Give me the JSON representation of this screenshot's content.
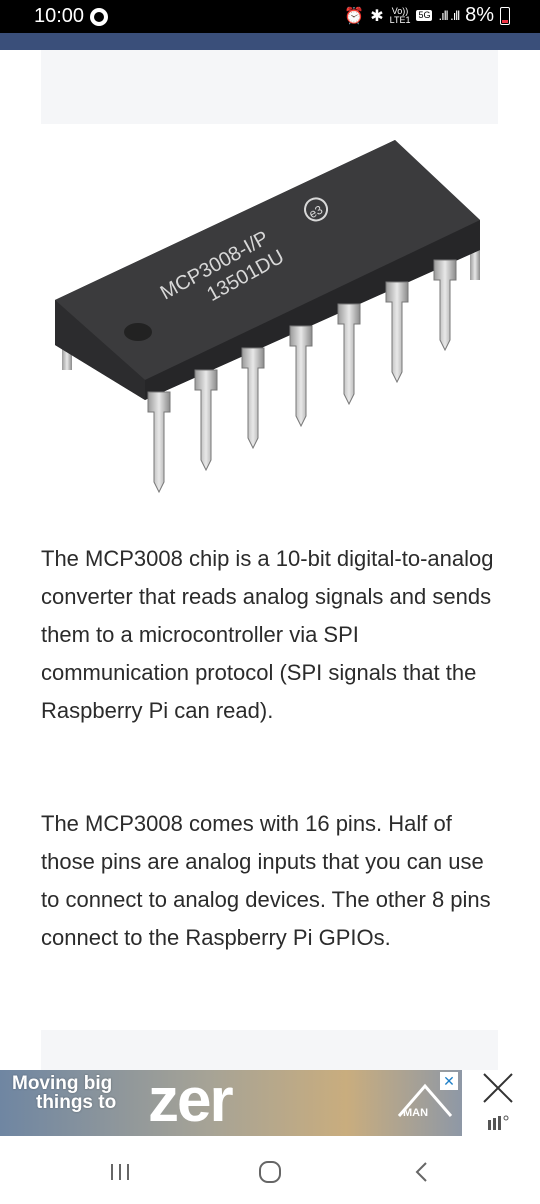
{
  "status_bar": {
    "time": "10:00",
    "network_top": "Vo))",
    "network_bottom": "LTE1",
    "network_5g": "5G",
    "signal": ".ıll .ıll",
    "battery": "8%"
  },
  "article": {
    "image_chip_line1": "MCP3008-I/P",
    "image_chip_line2": "13501DU",
    "image_badge": "e3",
    "paragraph_1": "The MCP3008 chip is a 10-bit digital-to-analog converter that reads analog signals and sends them to a microcontroller via SPI communication protocol (SPI signals that the Raspberry Pi can read).",
    "paragraph_2": "The MCP3008 comes with 16 pins. Half of those pins are analog inputs that you can use to connect to analog devices. The other 8 pins connect to the Raspberry Pi GPIOs."
  },
  "ad": {
    "line1": "Moving big",
    "line2": "things to",
    "brand": "zer",
    "logo": "MAN",
    "close_icon": "close-icon"
  },
  "nav": {
    "recents_icon": "recents-icon",
    "home_icon": "home-icon",
    "back_icon": "back-icon"
  },
  "colors": {
    "header_strip": "#3a4f7a",
    "text": "#2b2b2b",
    "placeholder": "#f5f6f8"
  }
}
